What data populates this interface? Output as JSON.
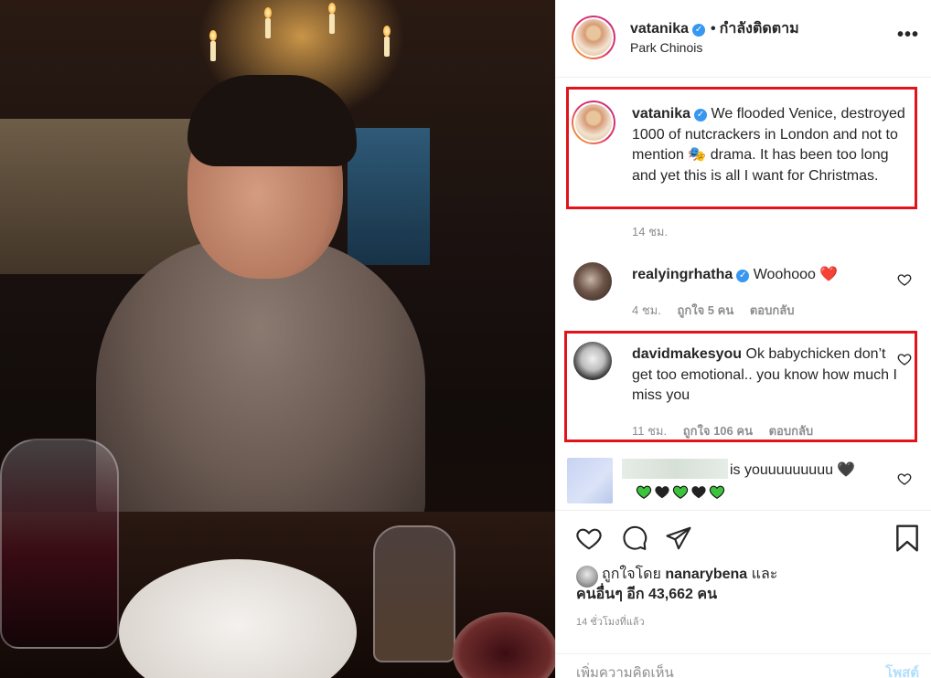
{
  "post": {
    "author": "vatanika",
    "following_label": "กำลังติดตาม",
    "location": "Park Chinois",
    "more_label": "•••"
  },
  "caption": {
    "username": "vatanika",
    "text": "We flooded Venice, destroyed 1000 of nutcrackers in London and not to mention 🎭 drama. It has been too long and yet this is all I want for Christmas.",
    "time": "14 ชม."
  },
  "comments": [
    {
      "username": "realyingrhatha",
      "verified": true,
      "text": "Woohooo ❤️",
      "time": "4 ชม.",
      "likes": "ถูกใจ 5 คน",
      "reply": "ตอบกลับ"
    },
    {
      "username": "davidmakesyou",
      "verified": false,
      "text": "Ok babychicken don’t get too emotional.. you know how much I miss you",
      "time": "11 ชม.",
      "likes": "ถูกใจ 106 คน",
      "reply": "ตอบกลับ"
    },
    {
      "username": "",
      "text": "is youuuuuuuuu 🖤",
      "emoji_line": [
        "green-heart",
        "black-heart",
        "green-heart",
        "black-heart",
        "green-heart"
      ]
    }
  ],
  "likes": {
    "prefix": "ถูกใจโดย",
    "liker": "nanarybena",
    "and": "และ",
    "others_prefix": "คนอื่นๆ อีก",
    "count": "43,662",
    "suffix": "คน"
  },
  "time_ago": "14 ชั่วโมงที่แล้ว",
  "add_comment": {
    "placeholder": "เพิ่มความคิดเห็น",
    "post_label": "โพสต์"
  },
  "colors": {
    "verified": "#3897f0",
    "highlight_box": "#e2141b",
    "muted": "#8e8e8e",
    "post_button_disabled": "#b2dffc"
  },
  "icons": [
    "heart-icon",
    "comment-icon",
    "share-icon",
    "bookmark-icon",
    "verified-badge-icon",
    "more-options-icon"
  ]
}
